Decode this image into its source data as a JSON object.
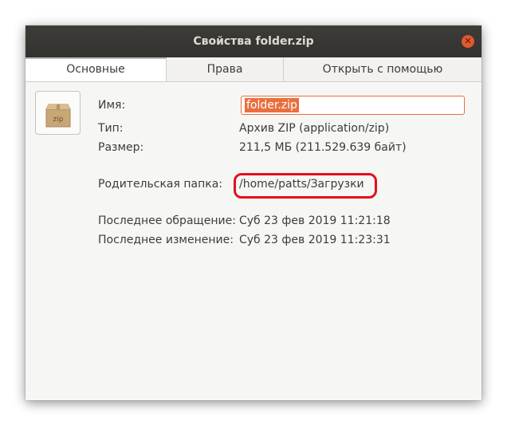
{
  "window": {
    "title": "Свойства folder.zip",
    "close_icon": "close-icon"
  },
  "tabs": [
    {
      "label": "Основные",
      "active": true
    },
    {
      "label": "Права",
      "active": false
    },
    {
      "label": "Открыть с помощью",
      "active": false
    }
  ],
  "file_icon": {
    "name": "zip-archive-icon",
    "text": "zip"
  },
  "props": {
    "name_label": "Имя:",
    "name_value": "folder.zip",
    "type_label": "Тип:",
    "type_value": "Архив ZIP (application/zip)",
    "size_label": "Размер:",
    "size_value": "211,5 МБ (211.529.639 байт)",
    "parent_label": "Родительская папка:",
    "parent_value": "/home/patts/Загрузки",
    "accessed_label": "Последнее обращение:",
    "accessed_value": "Суб 23 фев 2019 11:21:18",
    "modified_label": "Последнее изменение:",
    "modified_value": "Суб 23 фев 2019 11:23:31"
  },
  "colors": {
    "accent": "#e96f3f",
    "highlight_ring": "#e3111d",
    "titlebar": "#3d3c39"
  }
}
